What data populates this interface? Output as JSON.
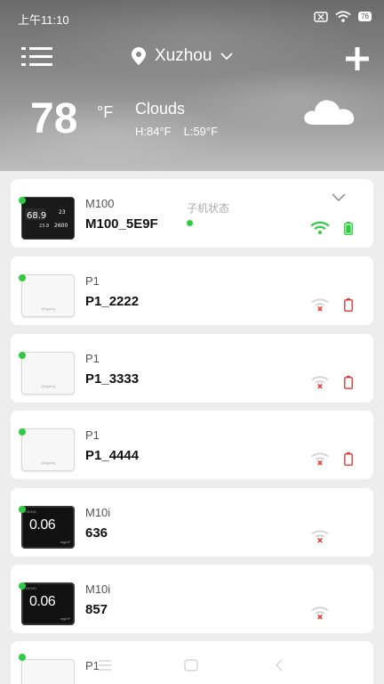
{
  "status_bar": {
    "time": "上午11:10",
    "battery": "76"
  },
  "header": {
    "location": "Xuzhou",
    "temperature": "78",
    "unit": "°F",
    "condition": "Clouds",
    "high": "H:84°F",
    "low": "L:59°F"
  },
  "devices": [
    {
      "model": "M100",
      "name": "M100_5E9F",
      "sub_label": "子机状态"
    },
    {
      "model": "P1",
      "name": "P1_2222"
    },
    {
      "model": "P1",
      "name": "P1_3333"
    },
    {
      "model": "P1",
      "name": "P1_4444"
    },
    {
      "model": "M10i",
      "name": "636"
    },
    {
      "model": "M10i",
      "name": "857"
    },
    {
      "model": "P1",
      "name": ""
    }
  ],
  "thumbs": {
    "m100": {
      "top_left": "68.9",
      "top_right": "23",
      "mid_left": "23.8",
      "mid_right": "2600"
    },
    "m10i": {
      "value": "0.06",
      "unit": "mg/m³",
      "label": "HCHO"
    },
    "p1_brand": "Qingping"
  },
  "colors": {
    "online": "#2ecc40",
    "offline_red": "#e53935",
    "wifi_ok": "#2ecc40"
  }
}
